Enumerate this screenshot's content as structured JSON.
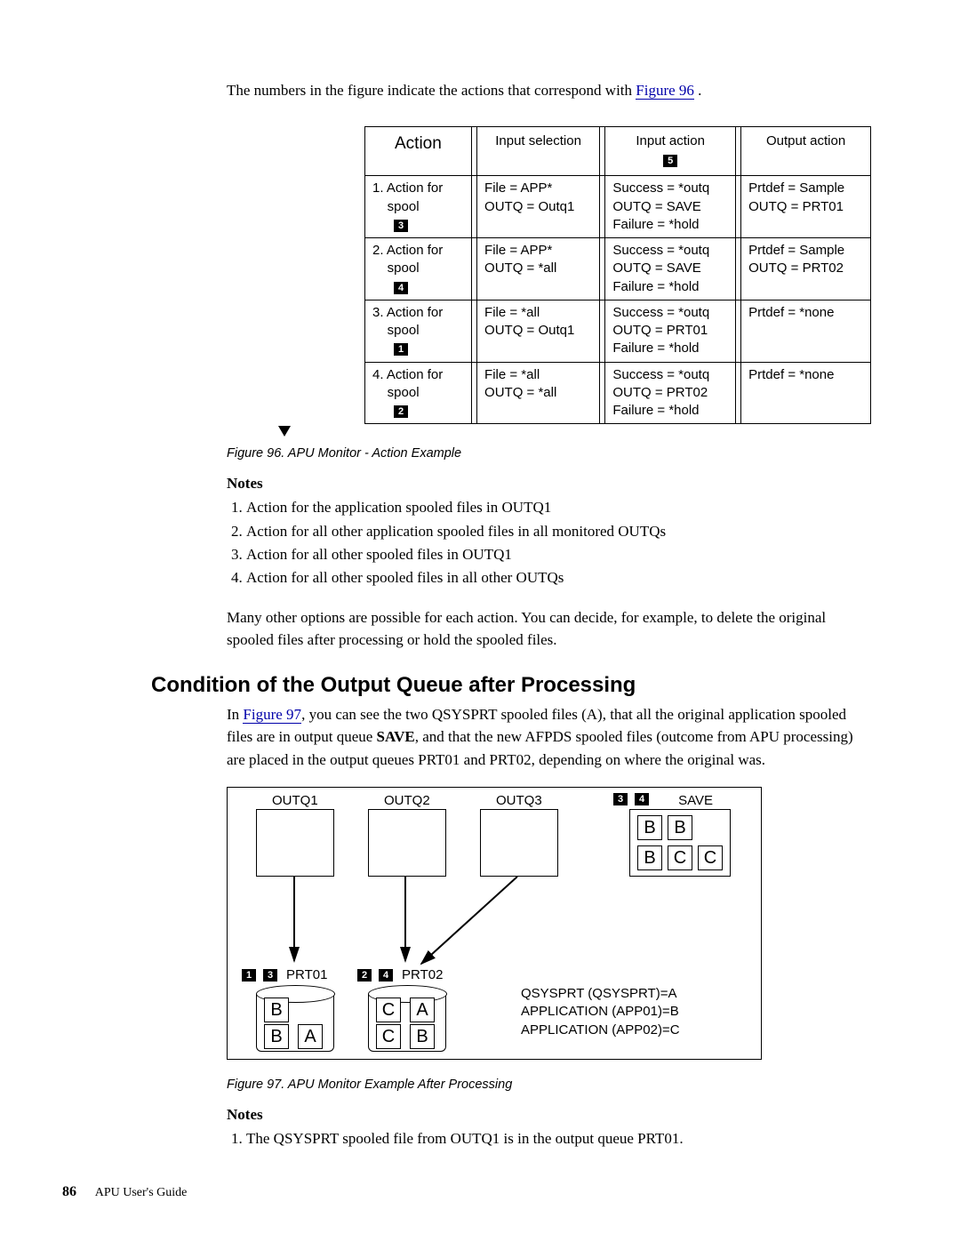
{
  "intro": {
    "prefix": "The numbers in the figure indicate the actions that correspond with ",
    "link": "Figure 96",
    "suffix": " ."
  },
  "fig96": {
    "headers": {
      "action": "Action",
      "input_selection": "Input selection",
      "input_action": "Input action",
      "input_action_badge": "5",
      "output_action": "Output action"
    },
    "rows": [
      {
        "n": "1.",
        "label": "Action for",
        "label2": "spool",
        "badge": "3",
        "isel": [
          "File = APP*",
          "OUTQ = Outq1"
        ],
        "iact": [
          "Success = *outq",
          "OUTQ = SAVE",
          "Failure = *hold"
        ],
        "oact": [
          "Prtdef = Sample",
          "OUTQ = PRT01"
        ]
      },
      {
        "n": "2.",
        "label": "Action for",
        "label2": "spool",
        "badge": "4",
        "isel": [
          "File = APP*",
          "OUTQ = *all"
        ],
        "iact": [
          "Success = *outq",
          "OUTQ = SAVE",
          "Failure = *hold"
        ],
        "oact": [
          "Prtdef = Sample",
          "OUTQ = PRT02"
        ]
      },
      {
        "n": "3.",
        "label": "Action for",
        "label2": "spool",
        "badge": "1",
        "isel": [
          "File = *all",
          "OUTQ = Outq1"
        ],
        "iact": [
          "Success = *outq",
          "OUTQ = PRT01",
          "Failure = *hold"
        ],
        "oact": [
          "Prtdef = *none"
        ]
      },
      {
        "n": "4.",
        "label": "Action for",
        "label2": "spool",
        "badge": "2",
        "isel": [
          "File = *all",
          "OUTQ = *all"
        ],
        "iact": [
          "Success = *outq",
          "OUTQ = PRT02",
          "Failure = *hold"
        ],
        "oact": [
          "Prtdef = *none"
        ]
      }
    ],
    "caption": "Figure 96. APU Monitor - Action Example",
    "notes_head": "Notes",
    "notes": [
      "Action for the application spooled files in OUTQ1",
      "Action for all other application spooled files in all monitored OUTQs",
      "Action for all other spooled files in OUTQ1",
      "Action for all other spooled files in all other OUTQs"
    ],
    "para": "Many other options are possible for each action. You can decide, for example, to delete the original spooled files after processing or hold the spooled files."
  },
  "section2": {
    "title": "Condition of the Output Queue after Processing",
    "body_prefix": "In ",
    "body_link": "Figure 97",
    "body_mid": ", you can see the two QSYSPRT spooled files (A), that all the original application spooled files are in output queue ",
    "body_bold": "SAVE",
    "body_suffix": ", and that the new AFPDS spooled files (outcome from APU processing) are placed in the output queues PRT01 and PRT02, depending on where the original was."
  },
  "fig97": {
    "labels": {
      "outq1": "OUTQ1",
      "outq2": "OUTQ2",
      "outq3": "OUTQ3",
      "save": "SAVE",
      "prt01": "PRT01",
      "prt02": "PRT02",
      "save_badges": [
        "3",
        "4"
      ],
      "prt01_badges": [
        "1",
        "3"
      ],
      "prt02_badges": [
        "2",
        "4"
      ]
    },
    "save_letters_row1": [
      "B",
      "B"
    ],
    "save_letters_row2": [
      "B",
      "C",
      "C"
    ],
    "prt01_letters": [
      [
        "B"
      ],
      [
        "B",
        "A"
      ]
    ],
    "prt02_letters": [
      [
        "C",
        "A"
      ],
      [
        "C",
        "B"
      ]
    ],
    "legend": [
      "QSYSPRT (QSYSPRT)=A",
      "APPLICATION (APP01)=B",
      "APPLICATION (APP02)=C"
    ],
    "caption": "Figure 97. APU Monitor Example After Processing",
    "notes_head": "Notes",
    "notes": [
      "The QSYSPRT spooled file from OUTQ1 is in the output queue PRT01."
    ]
  },
  "footer": {
    "page": "86",
    "title": "APU User's Guide"
  }
}
